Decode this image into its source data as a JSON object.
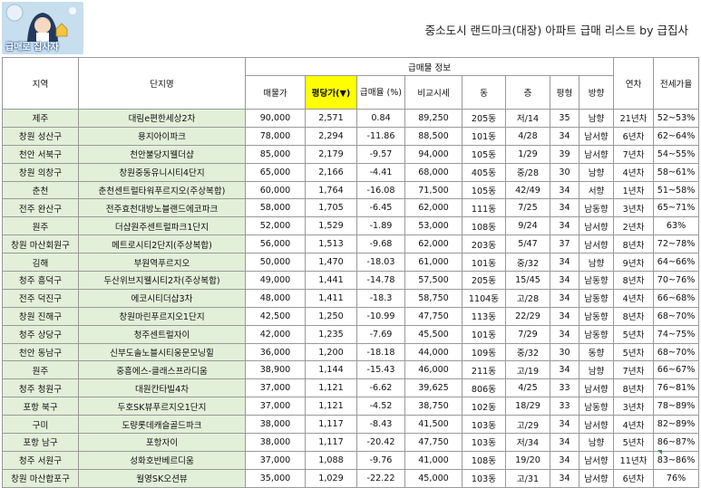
{
  "logo": {
    "text": "급매로 집사자"
  },
  "title": "중소도시 랜드마크(대장) 아파트 급매 리스트 by 급집사",
  "headers": {
    "region": "지역",
    "complex": "단지명",
    "group": "급매물 정보",
    "listing_price": "매물가",
    "price_per_pyeong": "평당가(▼)",
    "discount_rate": "급매율 (%)",
    "comparison": "비교시세",
    "dong": "동",
    "floor": "층",
    "pyeong": "평형",
    "direction": "방향",
    "year": "연차",
    "jeonse_ratio": "전세가율"
  },
  "rows": [
    {
      "region": "제주",
      "complex": "대림e편한세상2차",
      "price": "90,000",
      "ppp": "2,571",
      "rate": "0.84",
      "comp": "89,250",
      "dong": "205동",
      "floor": "저/14",
      "pyeong": "35",
      "dir": "남향",
      "year": "21년차",
      "jeonse": "52~53%"
    },
    {
      "region": "창원 성산구",
      "complex": "용지아이파크",
      "price": "78,000",
      "ppp": "2,294",
      "rate": "-11.86",
      "comp": "88,500",
      "dong": "101동",
      "floor": "4/28",
      "pyeong": "34",
      "dir": "남서향",
      "year": "6년차",
      "jeonse": "62~64%"
    },
    {
      "region": "천안 서북구",
      "complex": "천안불당지웰더샵",
      "price": "85,000",
      "ppp": "2,179",
      "rate": "-9.57",
      "comp": "94,000",
      "dong": "105동",
      "floor": "1/29",
      "pyeong": "39",
      "dir": "남서향",
      "year": "7년차",
      "jeonse": "54~55%"
    },
    {
      "region": "창원 의창구",
      "complex": "창원중동유니시티4단지",
      "price": "65,000",
      "ppp": "2,166",
      "rate": "-4.41",
      "comp": "68,000",
      "dong": "405동",
      "floor": "중/28",
      "pyeong": "30",
      "dir": "남향",
      "year": "4년차",
      "jeonse": "58~61%"
    },
    {
      "region": "춘천",
      "complex": "춘천센트럴타워푸르지오(주상복합)",
      "price": "60,000",
      "ppp": "1,764",
      "rate": "-16.08",
      "comp": "71,500",
      "dong": "105동",
      "floor": "42/49",
      "pyeong": "34",
      "dir": "서향",
      "year": "1년차",
      "jeonse": "51~58%"
    },
    {
      "region": "전주 완산구",
      "complex": "전주효천대방노블랜드에코파크",
      "price": "58,000",
      "ppp": "1,705",
      "rate": "-6.45",
      "comp": "62,000",
      "dong": "111동",
      "floor": "7/25",
      "pyeong": "34",
      "dir": "남동향",
      "year": "3년차",
      "jeonse": "65~71%"
    },
    {
      "region": "원주",
      "complex": "더샵원주센트럴파크1단지",
      "price": "52,000",
      "ppp": "1,529",
      "rate": "-1.89",
      "comp": "53,000",
      "dong": "108동",
      "floor": "9/24",
      "pyeong": "34",
      "dir": "남서향",
      "year": "2년차",
      "jeonse": "63%"
    },
    {
      "region": "창원 마산회원구",
      "complex": "메트로시티2단지(주상복합)",
      "price": "56,000",
      "ppp": "1,513",
      "rate": "-9.68",
      "comp": "62,000",
      "dong": "203동",
      "floor": "5/47",
      "pyeong": "37",
      "dir": "남서향",
      "year": "8년차",
      "jeonse": "72~78%"
    },
    {
      "region": "김해",
      "complex": "부원역푸르지오",
      "price": "50,000",
      "ppp": "1,470",
      "rate": "-18.03",
      "comp": "61,000",
      "dong": "101동",
      "floor": "중/32",
      "pyeong": "34",
      "dir": "남향",
      "year": "9년차",
      "jeonse": "64~66%"
    },
    {
      "region": "청주 흥덕구",
      "complex": "두산위브지웰시티2차(주상복합)",
      "price": "49,000",
      "ppp": "1,441",
      "rate": "-14.78",
      "comp": "57,500",
      "dong": "205동",
      "floor": "15/45",
      "pyeong": "34",
      "dir": "남동향",
      "year": "8년차",
      "jeonse": "70~76%"
    },
    {
      "region": "전주 덕진구",
      "complex": "에코시티더샵3차",
      "price": "48,000",
      "ppp": "1,411",
      "rate": "-18.3",
      "comp": "58,750",
      "dong": "1104동",
      "floor": "고/28",
      "pyeong": "34",
      "dir": "남동향",
      "year": "4년차",
      "jeonse": "66~68%"
    },
    {
      "region": "창원 진해구",
      "complex": "창원마린푸르지오1단지",
      "price": "42,500",
      "ppp": "1,250",
      "rate": "-10.99",
      "comp": "47,750",
      "dong": "113동",
      "floor": "22/29",
      "pyeong": "34",
      "dir": "남동향",
      "year": "8년차",
      "jeonse": "68~70%"
    },
    {
      "region": "청주 상당구",
      "complex": "청주센트럴자이",
      "price": "42,000",
      "ppp": "1,235",
      "rate": "-7.69",
      "comp": "45,500",
      "dong": "101동",
      "floor": "7/29",
      "pyeong": "34",
      "dir": "남동향",
      "year": "5년차",
      "jeonse": "74~75%"
    },
    {
      "region": "천안 동남구",
      "complex": "신부도솔노블시티웅문모닝힐",
      "price": "36,000",
      "ppp": "1,200",
      "rate": "-18.18",
      "comp": "44,000",
      "dong": "109동",
      "floor": "중/32",
      "pyeong": "30",
      "dir": "동향",
      "year": "5년차",
      "jeonse": "68~70%"
    },
    {
      "region": "원주",
      "complex": "중흥에스-클래스프라디움",
      "price": "38,900",
      "ppp": "1,144",
      "rate": "-15.43",
      "comp": "46,000",
      "dong": "211동",
      "floor": "고/19",
      "pyeong": "34",
      "dir": "남향",
      "year": "7년차",
      "jeonse": "66~67%"
    },
    {
      "region": "청주 청원구",
      "complex": "대원칸타빌4차",
      "price": "37,000",
      "ppp": "1,121",
      "rate": "-6.62",
      "comp": "39,625",
      "dong": "806동",
      "floor": "4/25",
      "pyeong": "33",
      "dir": "남서향",
      "year": "8년차",
      "jeonse": "76~81%"
    },
    {
      "region": "포항 북구",
      "complex": "두호SK뷰푸르지오1단지",
      "price": "37,000",
      "ppp": "1,121",
      "rate": "-4.52",
      "comp": "38,750",
      "dong": "102동",
      "floor": "18/29",
      "pyeong": "33",
      "dir": "남동향",
      "year": "3년차",
      "jeonse": "78~89%"
    },
    {
      "region": "구미",
      "complex": "도량롯데캐슬골드파크",
      "price": "38,000",
      "ppp": "1,117",
      "rate": "-8.43",
      "comp": "41,500",
      "dong": "103동",
      "floor": "고/29",
      "pyeong": "34",
      "dir": "남서향",
      "year": "4년차",
      "jeonse": "82~89%"
    },
    {
      "region": "포항 남구",
      "complex": "포항자이",
      "price": "38,000",
      "ppp": "1,117",
      "rate": "-20.42",
      "comp": "47,750",
      "dong": "103동",
      "floor": "저/34",
      "pyeong": "34",
      "dir": "남향",
      "year": "5년차",
      "jeonse": "86~87%"
    },
    {
      "region": "청주 서원구",
      "complex": "성화호반베르디움",
      "price": "37,000",
      "ppp": "1,088",
      "rate": "-9.76",
      "comp": "41,000",
      "dong": "108동",
      "floor": "19/20",
      "pyeong": "34",
      "dir": "남서향",
      "year": "11년차",
      "jeonse": "83~86%"
    },
    {
      "region": "창원 마산합포구",
      "complex": "월영SK오션뷰",
      "price": "35,000",
      "ppp": "1,029",
      "rate": "-22.22",
      "comp": "45,000",
      "dong": "103동",
      "floor": "고/31",
      "pyeong": "34",
      "dir": "남서향",
      "year": "6년차",
      "jeonse": "76%"
    }
  ]
}
